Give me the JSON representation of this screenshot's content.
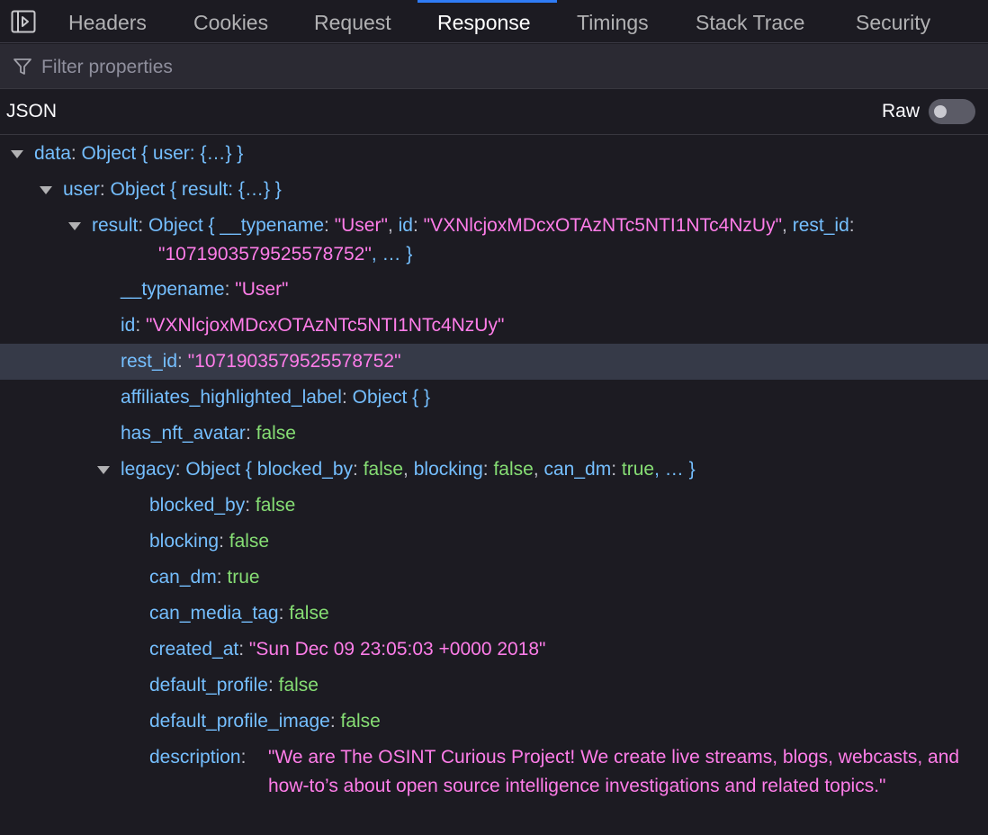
{
  "tabs": [
    "Headers",
    "Cookies",
    "Request",
    "Response",
    "Timings",
    "Stack Trace",
    "Security"
  ],
  "selected_tab": "Response",
  "filter": {
    "placeholder": "Filter properties",
    "value": ""
  },
  "json_panel": {
    "title": "JSON",
    "raw_label": "Raw",
    "raw_enabled": false
  },
  "tree": {
    "data_key": "data",
    "data_summary": "Object { user: {…} }",
    "user_key": "user",
    "user_summary": "Object { result: {…} }",
    "result_key": "result",
    "result_summary_prefix": "Object {",
    "result_summary_typename_key": "__typename",
    "result_summary_typename_val": "\"User\"",
    "result_summary_id_key": "id",
    "result_summary_id_val": "\"VXNlcjoxMDcxOTAzNTc5NTI1NTc4NzUy\"",
    "result_summary_restid_key": "rest_id",
    "result_summary_restid_val": "\"1071903579525578752\"",
    "result_summary_suffix": ", … }",
    "typename_key": "__typename",
    "typename_val": "\"User\"",
    "id_key": "id",
    "id_val": "\"VXNlcjoxMDcxOTAzNTc5NTI1NTc4NzUy\"",
    "restid_key": "rest_id",
    "restid_val": "\"1071903579525578752\"",
    "affiliates_key": "affiliates_highlighted_label",
    "affiliates_val": "Object {  }",
    "nft_key": "has_nft_avatar",
    "nft_val": "false",
    "legacy_key": "legacy",
    "legacy_summary_prefix": "Object {",
    "legacy_blocked_by_key": "blocked_by",
    "legacy_blocked_by_val": "false",
    "legacy_blocking_key": "blocking",
    "legacy_blocking_val": "false",
    "legacy_can_dm_key": "can_dm",
    "legacy_can_dm_val": "true",
    "legacy_summary_suffix": ", … }",
    "blocked_by_key": "blocked_by",
    "blocked_by_val": "false",
    "blocking_key": "blocking",
    "blocking_val": "false",
    "can_dm_key": "can_dm",
    "can_dm_val": "true",
    "can_media_tag_key": "can_media_tag",
    "can_media_tag_val": "false",
    "created_at_key": "created_at",
    "created_at_val": "\"Sun Dec 09 23:05:03 +0000 2018\"",
    "default_profile_key": "default_profile",
    "default_profile_val": "false",
    "default_profile_image_key": "default_profile_image",
    "default_profile_image_val": "false",
    "description_key": "description",
    "description_val": "\"We are The OSINT Curious Project! We create live streams, blogs, webcasts, and how-to’s about open source intelligence investigations and related topics.\""
  }
}
